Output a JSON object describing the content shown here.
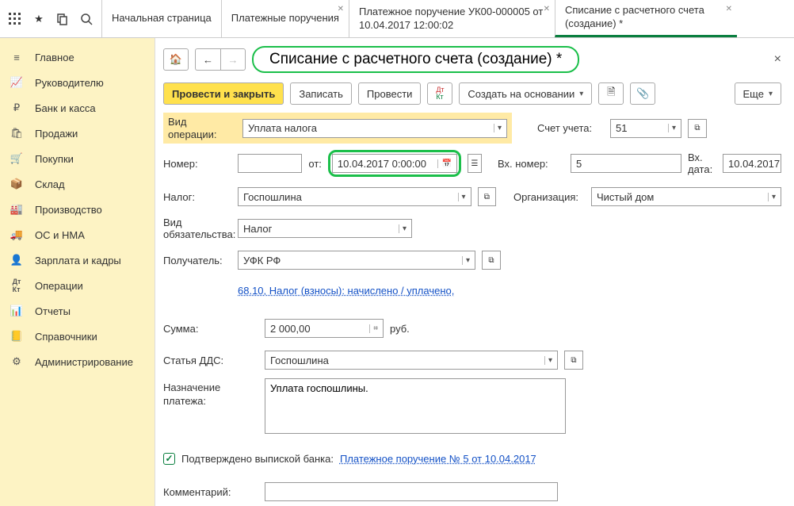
{
  "tabs": {
    "t0": "Начальная страница",
    "t1": "Платежные поручения",
    "t2": "Платежное поручение УК00-000005 от 10.04.2017 12:00:02",
    "t3": "Списание с расчетного счета (создание) *"
  },
  "sidebar": {
    "items": [
      "Главное",
      "Руководителю",
      "Банк и касса",
      "Продажи",
      "Покупки",
      "Склад",
      "Производство",
      "ОС и НМА",
      "Зарплата и кадры",
      "Операции",
      "Отчеты",
      "Справочники",
      "Администрирование"
    ]
  },
  "title": "Списание с расчетного счета (создание) *",
  "toolbar": {
    "post_close": "Провести и закрыть",
    "write": "Записать",
    "post": "Провести",
    "create_based": "Создать на основании",
    "more": "Еще"
  },
  "fields": {
    "op_type_label": "Вид операции:",
    "op_type_value": "Уплата налога",
    "account_label": "Счет учета:",
    "account_value": "51",
    "number_label": "Номер:",
    "number_value": "",
    "from_label": "от:",
    "date_value": "10.04.2017  0:00:00",
    "inc_num_label": "Вх. номер:",
    "inc_num_value": "5",
    "inc_date_label": "Вх. дата:",
    "inc_date_value": "10.04.2017",
    "tax_label": "Налог:",
    "tax_value": "Госпошлина",
    "org_label": "Организация:",
    "org_value": "Чистый дом",
    "obligation_label": "Вид обязательства:",
    "obligation_value": "Налог",
    "recipient_label": "Получатель:",
    "recipient_value": "УФК РФ",
    "tax_link": "68.10, Налог (взносы): начислено / уплачено,",
    "sum_label": "Сумма:",
    "sum_value": "2 000,00",
    "currency": "руб.",
    "dds_label": "Статья ДДС:",
    "dds_value": "Госпошлина",
    "purpose_label": "Назначение платежа:",
    "purpose_value": "Уплата госпошлины.",
    "confirmed_label": "Подтверждено выпиской банка:",
    "confirmed_link": "Платежное поручение № 5 от 10.04.2017",
    "comment_label": "Комментарий:",
    "comment_value": ""
  }
}
